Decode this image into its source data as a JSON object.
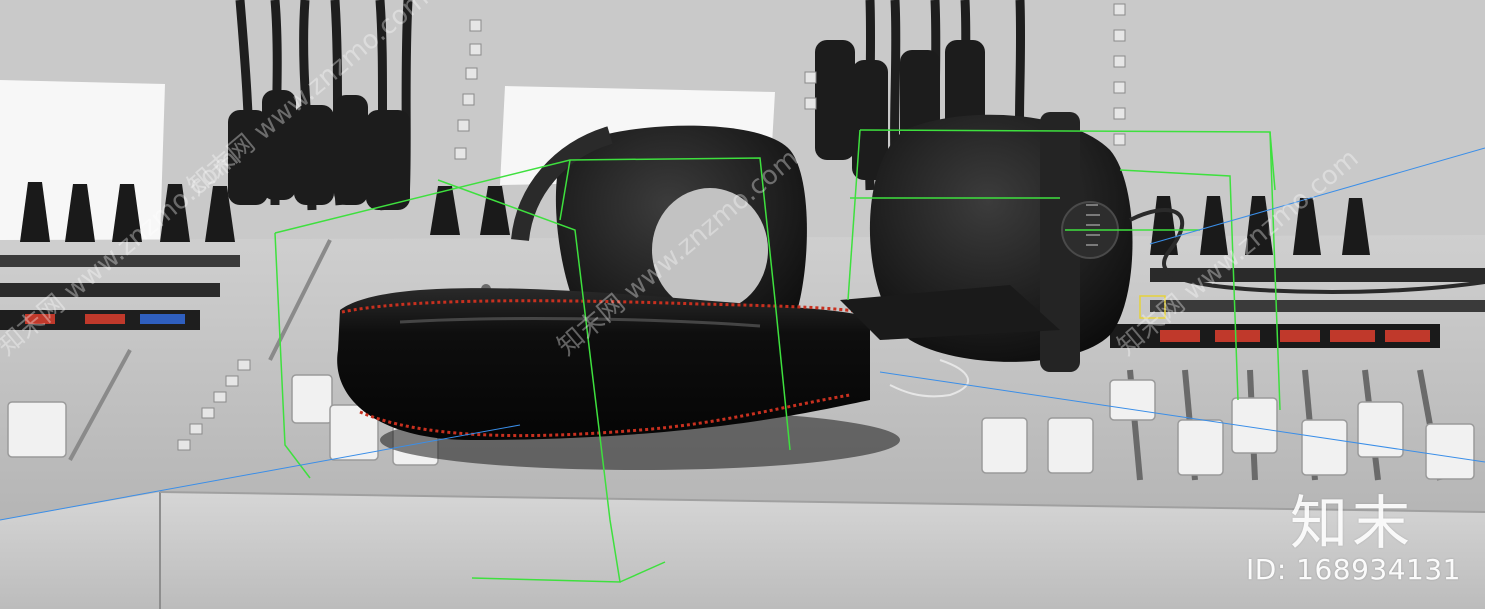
{
  "scene": {
    "subject": "headphones-on-mixing-console",
    "colors": {
      "console": "#c4c4c4",
      "console_shadow": "#9a9a9a",
      "headphone": "#161616",
      "headphone_highlight": "#5a5a5a",
      "stitch": "#c8301f",
      "bbox": "#3ee03e",
      "guide": "#3a8ee8",
      "led_red": "#c0392b",
      "led_blue": "#2f5fbf"
    }
  },
  "watermark": {
    "brand": "知末",
    "id_text": "ID: 168934131",
    "diagonal": [
      "知末网 www.znzmo.com",
      "知末网 www.znzmo.com",
      "知末网 www.znzmo.com",
      "知末网 www.znzmo.com"
    ]
  }
}
